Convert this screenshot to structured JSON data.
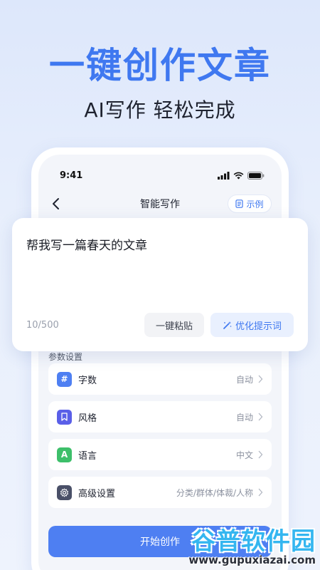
{
  "promo": {
    "headline": "一键创作文章",
    "subline": "AI写作  轻松完成"
  },
  "status_bar": {
    "time": "9:41"
  },
  "navbar": {
    "title": "智能写作",
    "example_label": "示例",
    "back_icon": "chevron-left-icon",
    "example_icon": "document-icon"
  },
  "prompt": {
    "text": "帮我写一篇春天的文章",
    "counter": "10/500",
    "paste_label": "一键粘贴",
    "optimize_label": "优化提示词",
    "optimize_icon": "magic-wand-icon"
  },
  "params": {
    "title": "参数设置",
    "rows": [
      {
        "label": "字数",
        "value": "自动",
        "icon": "hash-icon",
        "icon_glyph": "#",
        "color": "#4e7ff2"
      },
      {
        "label": "风格",
        "value": "自动",
        "icon": "bookmark-icon",
        "icon_glyph": "",
        "color": "#5a5fe8"
      },
      {
        "label": "语言",
        "value": "中文",
        "icon": "letter-a-icon",
        "icon_glyph": "A",
        "color": "#3dbf6a"
      },
      {
        "label": "高级设置",
        "value": "分类/群体/体裁/人称",
        "icon": "gear-icon",
        "icon_glyph": "",
        "color": "#4a5068"
      }
    ]
  },
  "start_button": {
    "label": "开始创作"
  },
  "watermark": {
    "top": "谷普软件园",
    "bottom": "www.gupuxiazai.com"
  },
  "colors": {
    "accent": "#4e7ff2",
    "headline": "#3f78f0",
    "background": "#e8effc"
  }
}
